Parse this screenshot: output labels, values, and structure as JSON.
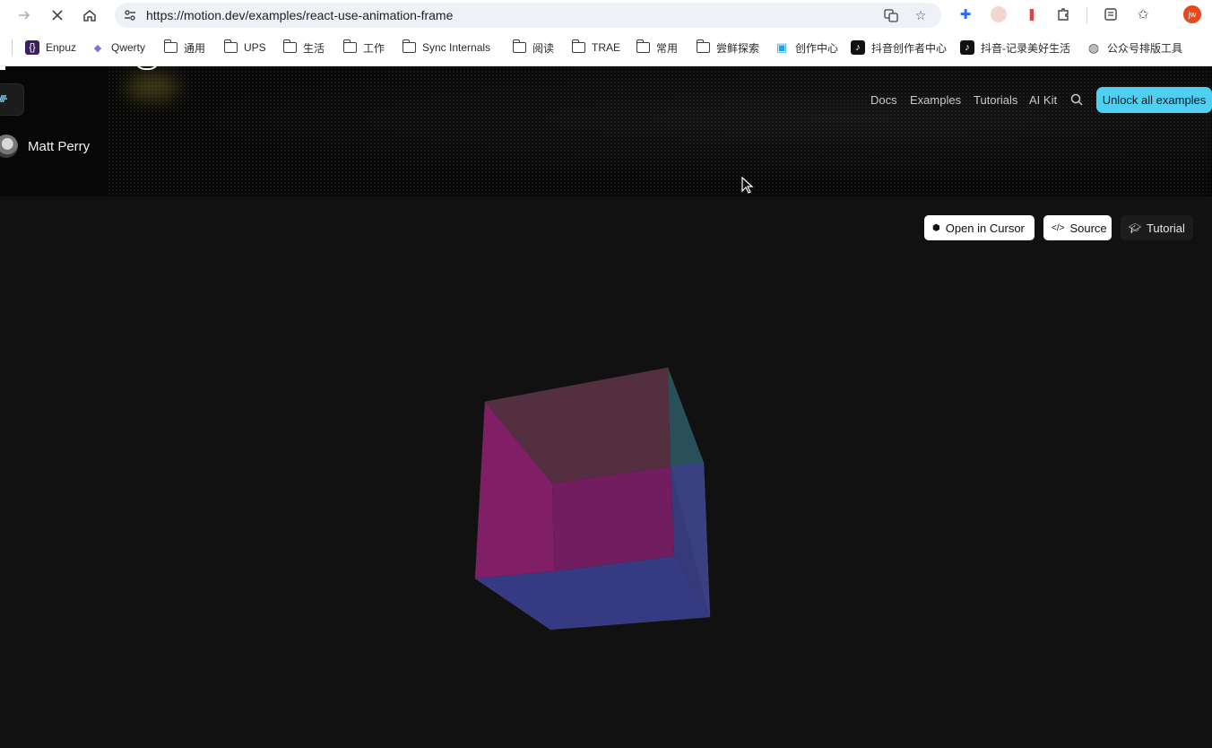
{
  "browser": {
    "url": "https://motion.dev/examples/react-use-animation-frame",
    "avatar_initials": "jw",
    "bookmarks": [
      {
        "label": "Enpuz",
        "icon": "enpuz-icon"
      },
      {
        "label": "Qwerty",
        "icon": "qwerty-icon"
      },
      {
        "label": "通用",
        "icon": "folder-icon"
      },
      {
        "label": "UPS",
        "icon": "folder-icon"
      },
      {
        "label": "生活",
        "icon": "folder-icon"
      },
      {
        "label": "工作",
        "icon": "folder-icon"
      },
      {
        "label": "Sync Internals",
        "icon": "folder-icon"
      },
      {
        "label": "阅读",
        "icon": "folder-icon"
      },
      {
        "label": "TRAE",
        "icon": "folder-icon"
      },
      {
        "label": "常用",
        "icon": "folder-icon"
      },
      {
        "label": "尝鲜探索",
        "icon": "folder-icon"
      },
      {
        "label": "创作中心",
        "icon": "bilibili-icon"
      },
      {
        "label": "抖音创作者中心",
        "icon": "tiktok-icon"
      },
      {
        "label": "抖音-记录美好生活",
        "icon": "tiktok-icon"
      },
      {
        "label": "公众号排版工具",
        "icon": "globe-icon"
      }
    ]
  },
  "site": {
    "nav": [
      "Docs",
      "Examples",
      "Tutorials",
      "AI Kit"
    ],
    "unlock_label": "Unlock all examples",
    "author": "Matt Perry",
    "accent": "#4fd0f2"
  },
  "demo": {
    "buttons": [
      {
        "label": "Open in Cursor",
        "icon": "cursor-cube-icon"
      },
      {
        "label": "Source",
        "icon": "code-icon"
      },
      {
        "label": "Tutorial",
        "icon": "graduation-cap-icon"
      }
    ],
    "cube_colors": {
      "magenta": "#8a1f6e",
      "blue": "#3a3f8f",
      "teal": "#2e5a66",
      "rose": "#5c3346"
    }
  }
}
